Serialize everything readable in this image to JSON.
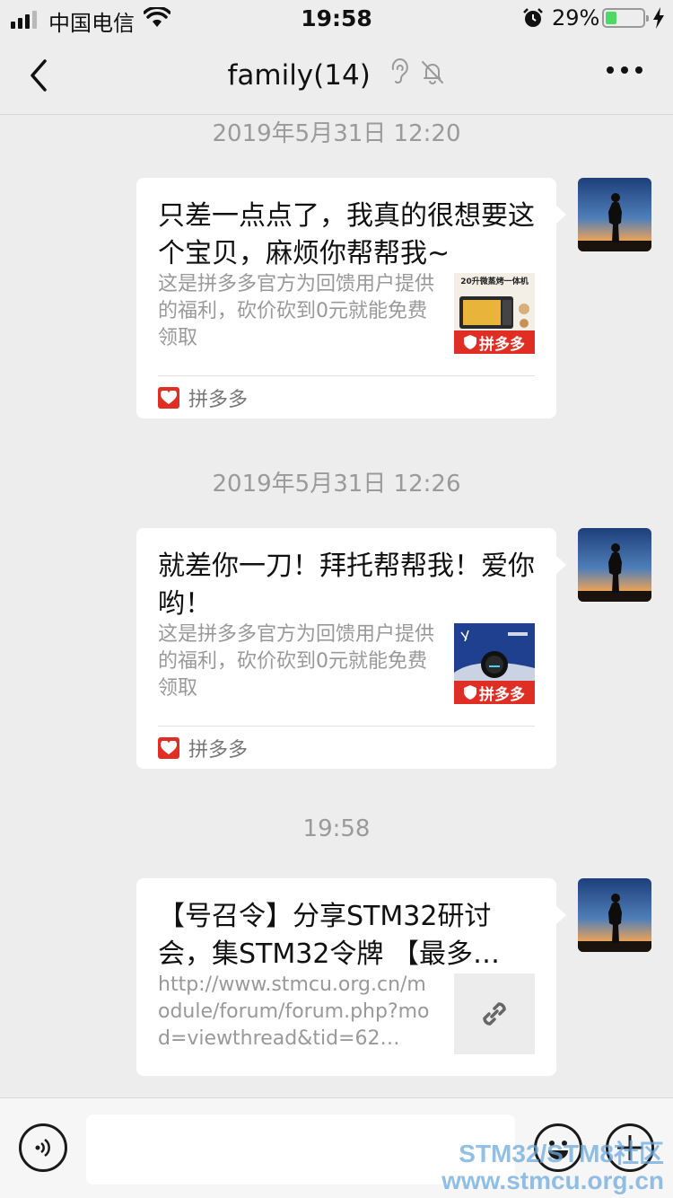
{
  "status_bar": {
    "carrier": "中国电信",
    "time": "19:58",
    "battery_percent": "29%",
    "battery_level": 0.29
  },
  "nav": {
    "title": "family(14)",
    "icons": [
      "chevron-left-icon",
      "ear-icon",
      "bell-muted-icon",
      "more-icon"
    ]
  },
  "messages": [
    {
      "timestamp": "2019年5月31日 12:20",
      "title": "只差一点点了，我真的很想要这个宝贝，麻烦你帮帮我~",
      "description": "这是拼多多官方为回馈用户提供的福利，砍价砍到0元就能免费领取",
      "thumb_caption": "20升微蒸烤一体机",
      "badge": "拼多多",
      "source": "拼多多"
    },
    {
      "timestamp": "2019年5月31日 12:26",
      "title": "就差你一刀！拜托帮帮我！爱你哟！",
      "description": "这是拼多多官方为回馈用户提供的福利，砍价砍到0元就能免费领取",
      "badge": "拼多多",
      "source": "拼多多"
    },
    {
      "timestamp": "19:58",
      "title": "【号召令】分享STM32研讨会，集STM32令牌 【最多…",
      "url": "http://www.stmcu.org.cn/module/forum/forum.php?mod=viewthread&tid=62…",
      "thumb_icon": "link-icon"
    }
  ],
  "input_bar": {
    "placeholder": "",
    "icons": [
      "voice-icon",
      "emoji-icon",
      "plus-icon"
    ]
  },
  "watermark": {
    "line1": "STM32/STM8社区",
    "line2": "www.stmcu.org.cn"
  }
}
